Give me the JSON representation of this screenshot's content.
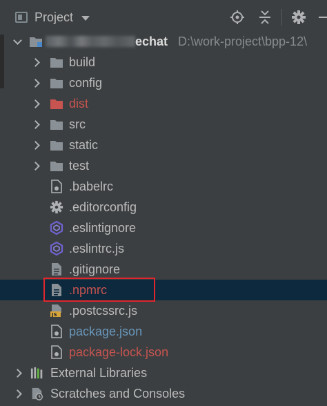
{
  "header": {
    "title": "Project",
    "icons": [
      "project-view-icon",
      "dropdown-caret-icon",
      "locate-target-icon",
      "collapse-all-icon",
      "settings-gear-icon",
      "hide-panel-icon"
    ]
  },
  "tree": {
    "root": {
      "name_visible_suffix": "echat",
      "path": "D:\\work-project\\bpp-12\\"
    },
    "folders": [
      {
        "label": "build",
        "state": "collapsed"
      },
      {
        "label": "config",
        "state": "collapsed"
      },
      {
        "label": "dist",
        "state": "collapsed",
        "color": "#c75450"
      },
      {
        "label": "src",
        "state": "collapsed"
      },
      {
        "label": "static",
        "state": "collapsed"
      },
      {
        "label": "test",
        "state": "collapsed"
      }
    ],
    "files": [
      {
        "label": ".babelrc",
        "icon": "config-file-icon"
      },
      {
        "label": ".editorconfig",
        "icon": "gear-file-icon"
      },
      {
        "label": ".eslintignore",
        "icon": "eslint-icon"
      },
      {
        "label": ".eslintrc.js",
        "icon": "eslint-icon"
      },
      {
        "label": ".gitignore",
        "icon": "text-file-icon"
      },
      {
        "label": ".npmrc",
        "icon": "text-file-icon",
        "selected": true
      },
      {
        "label": ".postcssrc.js",
        "icon": "js-file-icon"
      },
      {
        "label": "package.json",
        "icon": "json-file-icon",
        "color": "#6897bb"
      },
      {
        "label": "package-lock.json",
        "icon": "json-file-icon",
        "color": "#c75450"
      }
    ],
    "external_libraries": {
      "label": "External Libraries"
    },
    "scratches": {
      "label": "Scratches and Consoles"
    }
  },
  "colors": {
    "background": "#3c3f41",
    "selection": "#0d293e",
    "highlight_border": "#e0262c",
    "ignored_red": "#c75450",
    "modified_blue": "#6897bb",
    "folder_grey": "#8a9196"
  }
}
